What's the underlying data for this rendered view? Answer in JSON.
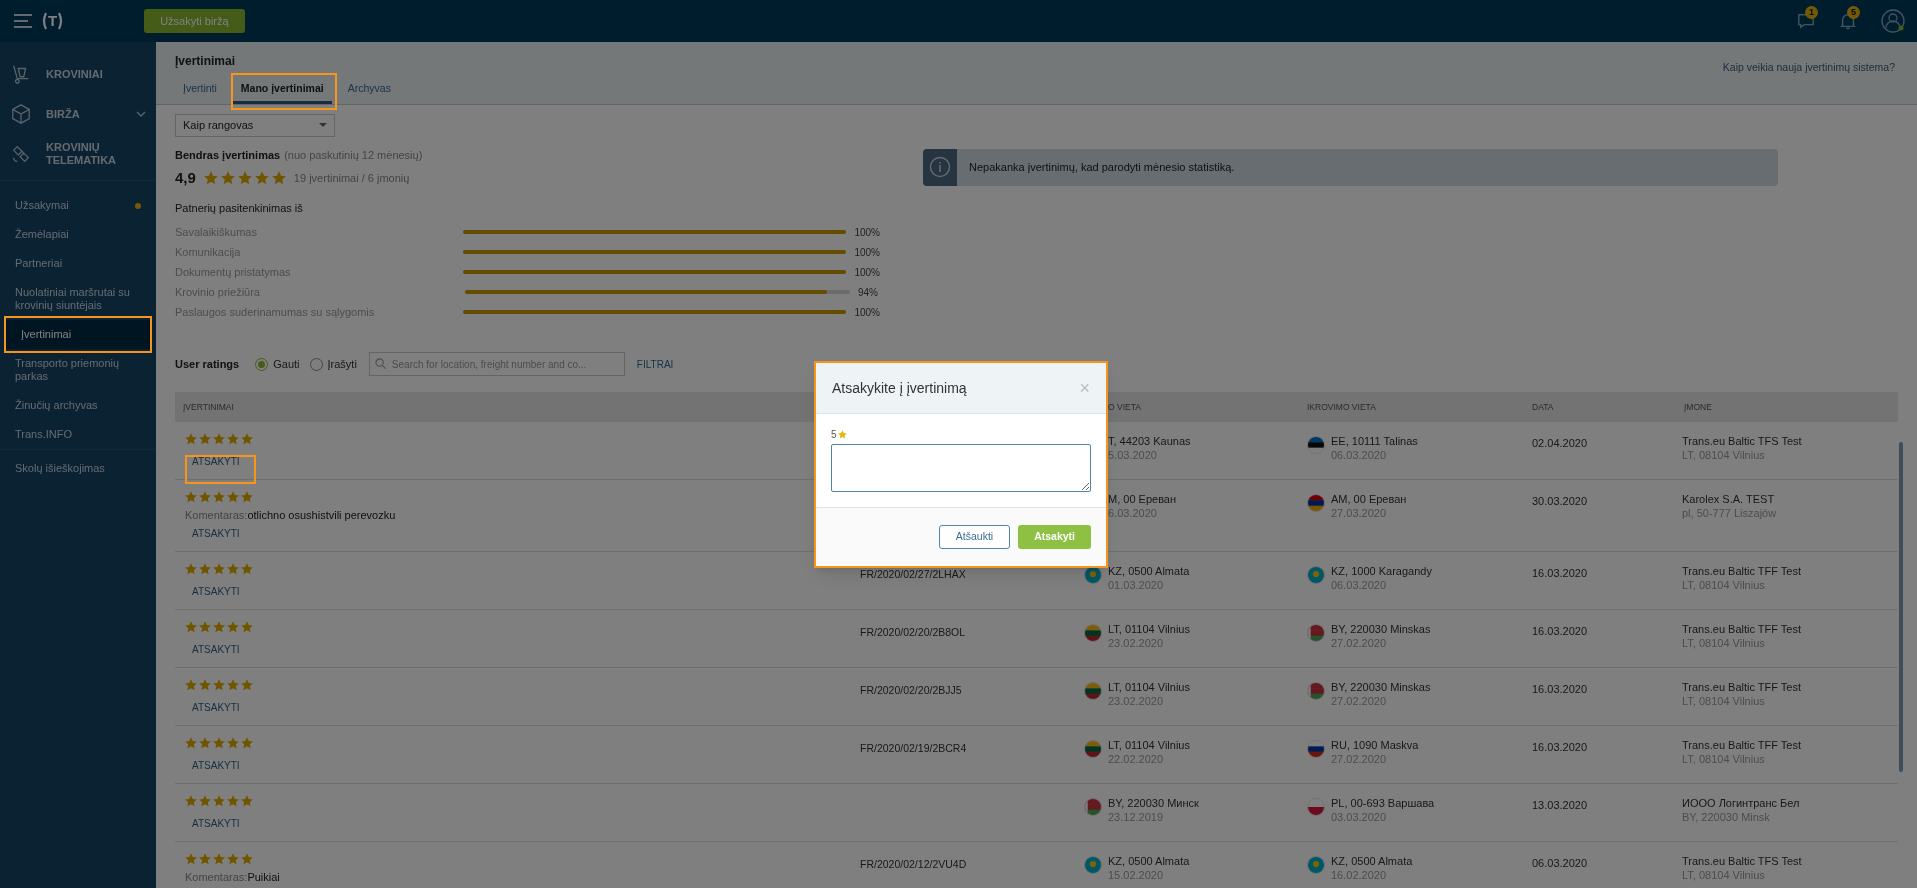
{
  "topbar": {
    "logo": "T",
    "order_button": "Užsakyti biržą",
    "messages_badge": "1",
    "notifications_badge": "5"
  },
  "sidebar": {
    "sections": [
      {
        "label": "KROVINIAI",
        "kind": "hand-truck",
        "chevron": false
      },
      {
        "label": "BIRŽA",
        "kind": "cube",
        "chevron": true
      },
      {
        "label": "KROVINIŲ TELEMATIKA",
        "kind": "satellite",
        "chevron": false
      }
    ],
    "items": [
      {
        "label": "Užsakymai",
        "selected": false,
        "dot": true,
        "divider_after": false
      },
      {
        "label": "Žemėlapiai",
        "selected": false,
        "dot": false,
        "divider_after": false
      },
      {
        "label": "Partneriai",
        "selected": false,
        "dot": false,
        "divider_after": false
      },
      {
        "label": "Nuolatiniai maršrutai su krovinių siuntėjais",
        "selected": false,
        "dot": false,
        "divider_after": false
      },
      {
        "label": "Įvertinimai",
        "selected": true,
        "dot": false,
        "divider_after": false
      },
      {
        "label": "Transporto priemonių parkas",
        "selected": false,
        "dot": false,
        "divider_after": false
      },
      {
        "label": "Žinučių archyvas",
        "selected": false,
        "dot": false,
        "divider_after": false
      },
      {
        "label": "Trans.INFO",
        "selected": false,
        "dot": false,
        "divider_after": true
      },
      {
        "label": "Skolų išieškojimas",
        "selected": false,
        "dot": false,
        "divider_after": false
      }
    ]
  },
  "page": {
    "title": "Įvertinimai",
    "help_link": "Kaip veikia nauja įvertinimų sistema?",
    "tabs": [
      {
        "label": "Įvertinti",
        "selected": false
      },
      {
        "label": "Mano įvertinimai",
        "selected": true
      },
      {
        "label": "Archyvas",
        "selected": false
      }
    ]
  },
  "summary": {
    "role_select": "Kaip rangovas",
    "title": "Bendras įvertinimas",
    "period": "(nuo paskutinių 12 mėnesių)",
    "score": "4,9",
    "stars": 5,
    "count": "19 įvertinimai / 6 įmonių",
    "satisfaction_title": "Patnerių pasitenkinimas iš",
    "criteria": [
      {
        "label": "Savalaikiškumas",
        "level": 1,
        "reading": "100%"
      },
      {
        "label": "Komunikacija",
        "level": 1,
        "reading": "100%"
      },
      {
        "label": "Dokumentų pristatymas",
        "level": 1,
        "reading": "100%"
      },
      {
        "label": "Krovinio priežiūra",
        "level": 0.94,
        "reading": "94%"
      },
      {
        "label": "Paslaugos suderinamumas su sąlygomis",
        "level": 1,
        "reading": "100%"
      }
    ],
    "info": "Nepakanka įvertinimų, kad parodyti mėnesio statistiką."
  },
  "filters": {
    "title": "User ratings",
    "radios": [
      {
        "label": "Gauti",
        "selected": true
      },
      {
        "label": "Įrašyti",
        "selected": false
      }
    ],
    "search_placeholder": "Search for location, freight number and co...",
    "filters_link": "FILTRAI"
  },
  "table": {
    "columns": [
      "ĮVERTINIMAI",
      "O VIETA",
      "IKROVIMO VIETA",
      "DATA",
      "ĮMONE"
    ],
    "rows": [
      {
        "stars": 5,
        "action": "ATSAKYTI",
        "load": {
          "place": "T, 44203 Kaunas",
          "date": "5.03.2020"
        },
        "unload": {
          "kind": "ee",
          "place": "EE, 10111 Talinas",
          "date": "06.03.2020"
        },
        "date": "02.04.2020",
        "company": "Trans.eu Baltic TFS Test",
        "company_address": "LT, 08104 Vilnius"
      },
      {
        "stars": 5,
        "comment_label": "Komentaras:",
        "comment": "otlichno osushistvili perevozku",
        "action": "ATSAKYTI",
        "load": {
          "place": "M, 00 Ереван",
          "date": "6.03.2020"
        },
        "unload": {
          "kind": "am",
          "place": "AM, 00 Ереван",
          "date": "27.03.2020"
        },
        "date": "30.03.2020",
        "company": "Karolex S.A. TEST",
        "company_address": "pl, 50-777 Liszajów"
      },
      {
        "stars": 5,
        "action": "ATSAKYTI",
        "freight": "FR/2020/02/27/2LHAX",
        "load": {
          "kind": "kz",
          "place": "KZ, 0500 Almata",
          "date": "01.03.2020"
        },
        "unload": {
          "kind": "kz",
          "place": "KZ, 1000 Karagandy",
          "date": "06.03.2020"
        },
        "date": "16.03.2020",
        "company": "Trans.eu Baltic TFF Test",
        "company_address": "LT, 08104 Vilnius"
      },
      {
        "stars": 5,
        "action": "ATSAKYTI",
        "freight": "FR/2020/02/20/2B8OL",
        "load": {
          "kind": "lt",
          "place": "LT, 01104 Vilnius",
          "date": "23.02.2020"
        },
        "unload": {
          "kind": "by",
          "place": "BY, 220030 Minskas",
          "date": "27.02.2020"
        },
        "date": "16.03.2020",
        "company": "Trans.eu Baltic TFF Test",
        "company_address": "LT, 08104 Vilnius"
      },
      {
        "stars": 5,
        "action": "ATSAKYTI",
        "freight": "FR/2020/02/20/2BJJ5",
        "load": {
          "kind": "lt",
          "place": "LT, 01104 Vilnius",
          "date": "23.02.2020"
        },
        "unload": {
          "kind": "by",
          "place": "BY, 220030 Minskas",
          "date": "27.02.2020"
        },
        "date": "16.03.2020",
        "company": "Trans.eu Baltic TFF Test",
        "company_address": "LT, 08104 Vilnius"
      },
      {
        "stars": 5,
        "action": "ATSAKYTI",
        "freight": "FR/2020/02/19/2BCR4",
        "load": {
          "kind": "lt",
          "place": "LT, 01104 Vilnius",
          "date": "22.02.2020"
        },
        "unload": {
          "kind": "ru",
          "place": "RU, 1090 Maskva",
          "date": "27.02.2020"
        },
        "date": "16.03.2020",
        "company": "Trans.eu Baltic TFF Test",
        "company_address": "LT, 08104 Vilnius"
      },
      {
        "stars": 5,
        "action": "ATSAKYTI",
        "load": {
          "kind": "by",
          "place": "BY, 220030 Минск",
          "date": "23.12.2019"
        },
        "unload": {
          "kind": "pl",
          "place": "PL, 00-693 Варшава",
          "date": "03.03.2020"
        },
        "date": "13.03.2020",
        "company": "ИООО Логинтранс Бел",
        "company_address": "BY, 220030 Minsk"
      },
      {
        "stars": 5,
        "comment_label": "Komentaras:",
        "comment": "Puikiai",
        "freight": "FR/2020/02/12/2VU4D",
        "load": {
          "kind": "kz",
          "place": "KZ, 0500 Almata",
          "date": "15.02.2020"
        },
        "unload": {
          "kind": "kz",
          "place": "KZ, 0500 Almata",
          "date": "16.02.2020"
        },
        "date": "06.03.2020",
        "company": "Trans.eu Baltic TFS Test",
        "company_address": "LT, 08104 Vilnius"
      }
    ]
  },
  "modal": {
    "title": "Atsakykite į įvertinimą",
    "close": "×",
    "rating": "5",
    "cancel": "Atšaukti",
    "submit": "Atsakyti"
  }
}
